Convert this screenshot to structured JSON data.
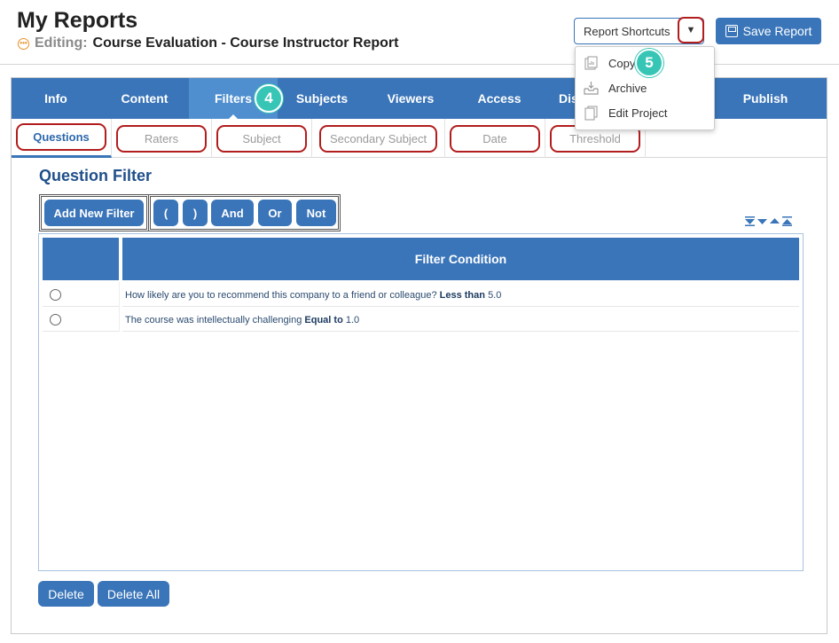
{
  "header": {
    "title": "My Reports",
    "editing_prefix": "Editing:",
    "editing_name": "Course Evaluation - Course Instructor Report",
    "shortcuts_label": "Report Shortcuts",
    "save_label": "Save Report"
  },
  "shortcuts_menu": {
    "items": [
      {
        "label": "Copy",
        "icon": "copy-report-icon"
      },
      {
        "label": "Archive",
        "icon": "archive-icon"
      },
      {
        "label": "Edit Project",
        "icon": "edit-project-icon"
      }
    ],
    "step_badge": "5"
  },
  "main_tabs": {
    "items": [
      "Info",
      "Content",
      "Filters",
      "Subjects",
      "Viewers",
      "Access",
      "Dis",
      "Publish"
    ],
    "active": "Filters",
    "step_badge": "4"
  },
  "sub_tabs": {
    "items": [
      "Questions",
      "Raters",
      "Subject",
      "Secondary Subject",
      "Date",
      "Threshold"
    ],
    "active": "Questions"
  },
  "section_title": "Question Filter",
  "toolbar": {
    "add_new_filter": "Add New Filter",
    "open_paren": "(",
    "close_paren": ")",
    "and": "And",
    "or": "Or",
    "not": "Not"
  },
  "grid": {
    "column_header": "Filter Condition",
    "rows": [
      {
        "question": "How likely are you to recommend this company to a friend or colleague?",
        "operator": "Less than",
        "value": "5.0"
      },
      {
        "question": "The course was intellectually challenging",
        "operator": "Equal to",
        "value": "1.0"
      }
    ]
  },
  "footer": {
    "delete": "Delete",
    "delete_all": "Delete All"
  },
  "colors": {
    "primary": "#3a75b9",
    "active_tab": "#4f8fd0",
    "annotation_red": "#b21d1d",
    "badge_teal": "#37c6b6",
    "editing_orange": "#e8902a"
  }
}
